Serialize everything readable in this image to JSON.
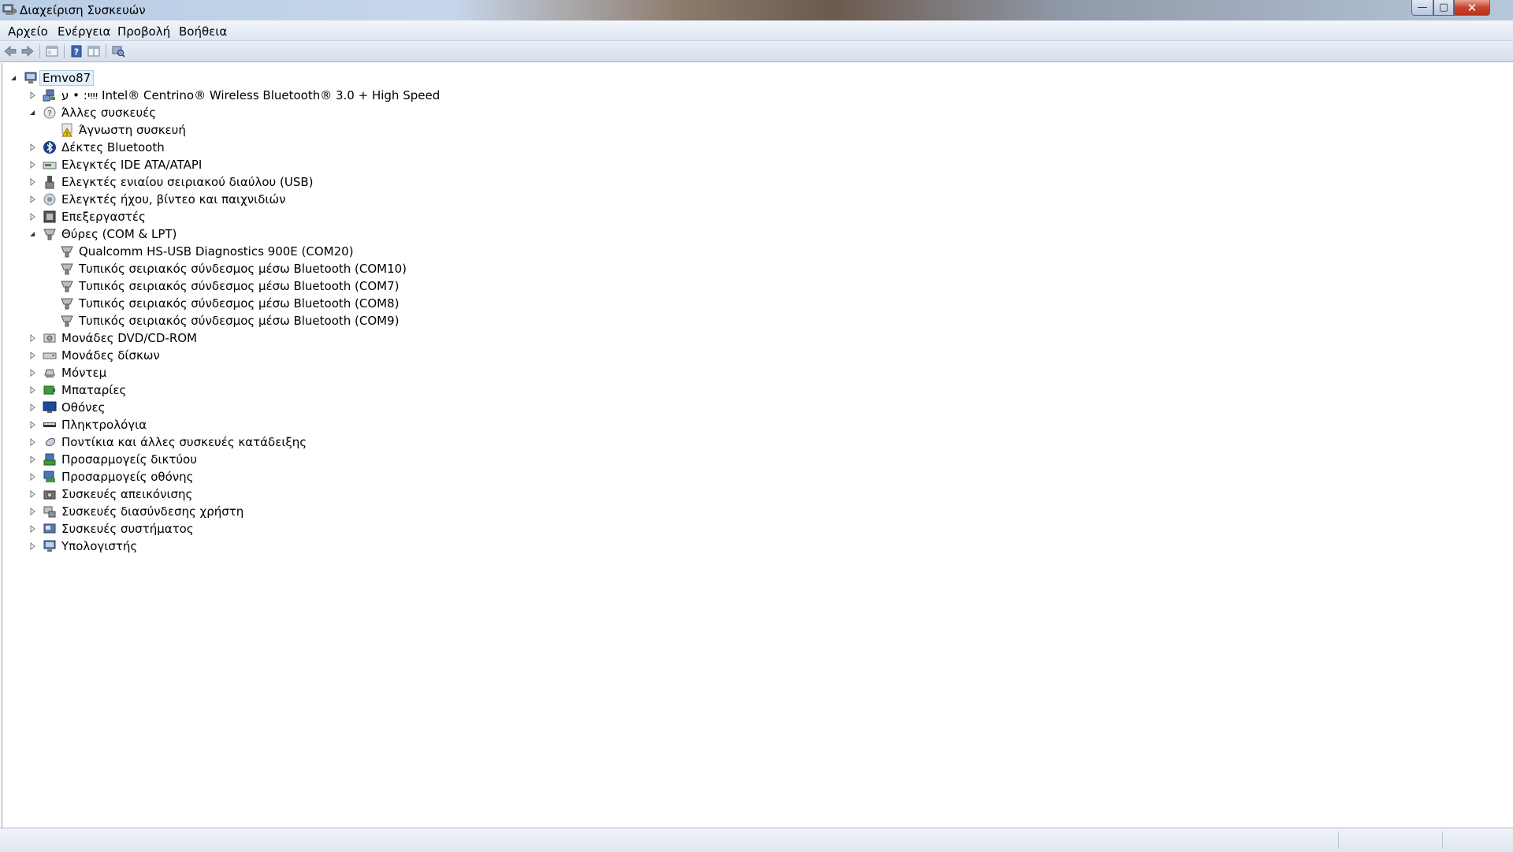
{
  "window": {
    "title": "Διαχείριση Συσκευών",
    "buttons": {
      "minimize": "—",
      "maximize": "▢",
      "close": "✕"
    }
  },
  "menu": [
    "Αρχείο",
    "Ενέργεια",
    "Προβολή",
    "Βοήθεια"
  ],
  "toolbar": [
    "back-icon",
    "forward-icon",
    "properties-icon",
    "help-icon",
    "details-icon",
    "scan-hardware-icon"
  ],
  "tree": {
    "root": "Emvo87",
    "items": [
      {
        "label": "יִיִיִי: • ע Intel® Centrino® Wireless Bluetooth® 3.0 + High Speed",
        "icon": "network-icon",
        "state": "collapsed"
      },
      {
        "label": "Άλλες συσκευές",
        "icon": "unknown-device-icon",
        "state": "expanded",
        "children": [
          {
            "label": "Άγνωστη συσκευή",
            "icon": "warning-device-icon"
          }
        ]
      },
      {
        "label": "Δέκτες Bluetooth",
        "icon": "bluetooth-icon",
        "state": "collapsed"
      },
      {
        "label": "Ελεγκτές IDE ATA/ATAPI",
        "icon": "ide-controller-icon",
        "state": "collapsed"
      },
      {
        "label": "Ελεγκτές ενιαίου σειριακού διαύλου (USB)",
        "icon": "usb-icon",
        "state": "collapsed"
      },
      {
        "label": "Ελεγκτές ήχου, βίντεο και παιχνιδιών",
        "icon": "sound-icon",
        "state": "collapsed"
      },
      {
        "label": "Επεξεργαστές",
        "icon": "processor-icon",
        "state": "collapsed"
      },
      {
        "label": "Θύρες (COM & LPT)",
        "icon": "port-icon",
        "state": "expanded",
        "children": [
          {
            "label": "Qualcomm HS-USB Diagnostics 900E (COM20)",
            "icon": "port-icon"
          },
          {
            "label": "Τυπικός σειριακός σύνδεσμος μέσω Bluetooth (COM10)",
            "icon": "port-icon"
          },
          {
            "label": "Τυπικός σειριακός σύνδεσμος μέσω Bluetooth (COM7)",
            "icon": "port-icon"
          },
          {
            "label": "Τυπικός σειριακός σύνδεσμος μέσω Bluetooth (COM8)",
            "icon": "port-icon"
          },
          {
            "label": "Τυπικός σειριακός σύνδεσμος μέσω Bluetooth (COM9)",
            "icon": "port-icon"
          }
        ]
      },
      {
        "label": "Μονάδες DVD/CD-ROM",
        "icon": "dvd-icon",
        "state": "collapsed"
      },
      {
        "label": "Μονάδες δίσκων",
        "icon": "disk-icon",
        "state": "collapsed"
      },
      {
        "label": "Μόντεμ",
        "icon": "modem-icon",
        "state": "collapsed"
      },
      {
        "label": "Μπαταρίες",
        "icon": "battery-icon",
        "state": "collapsed"
      },
      {
        "label": "Οθόνες",
        "icon": "monitor-icon",
        "state": "collapsed"
      },
      {
        "label": "Πληκτρολόγια",
        "icon": "keyboard-icon",
        "state": "collapsed"
      },
      {
        "label": "Ποντίκια και άλλες συσκευές κατάδειξης",
        "icon": "mouse-icon",
        "state": "collapsed"
      },
      {
        "label": "Προσαρμογείς δικτύου",
        "icon": "network-adapter-icon",
        "state": "collapsed"
      },
      {
        "label": "Προσαρμογείς οθόνης",
        "icon": "display-adapter-icon",
        "state": "collapsed"
      },
      {
        "label": "Συσκευές απεικόνισης",
        "icon": "camera-icon",
        "state": "collapsed"
      },
      {
        "label": "Συσκευές διασύνδεσης χρήστη",
        "icon": "hid-icon",
        "state": "collapsed"
      },
      {
        "label": "Συσκευές συστήματος",
        "icon": "system-device-icon",
        "state": "collapsed"
      },
      {
        "label": "Υπολογιστής",
        "icon": "computer-icon",
        "state": "collapsed"
      }
    ]
  },
  "colors": {
    "selection": "#e5eef9",
    "accent": "#3a6ea5"
  }
}
